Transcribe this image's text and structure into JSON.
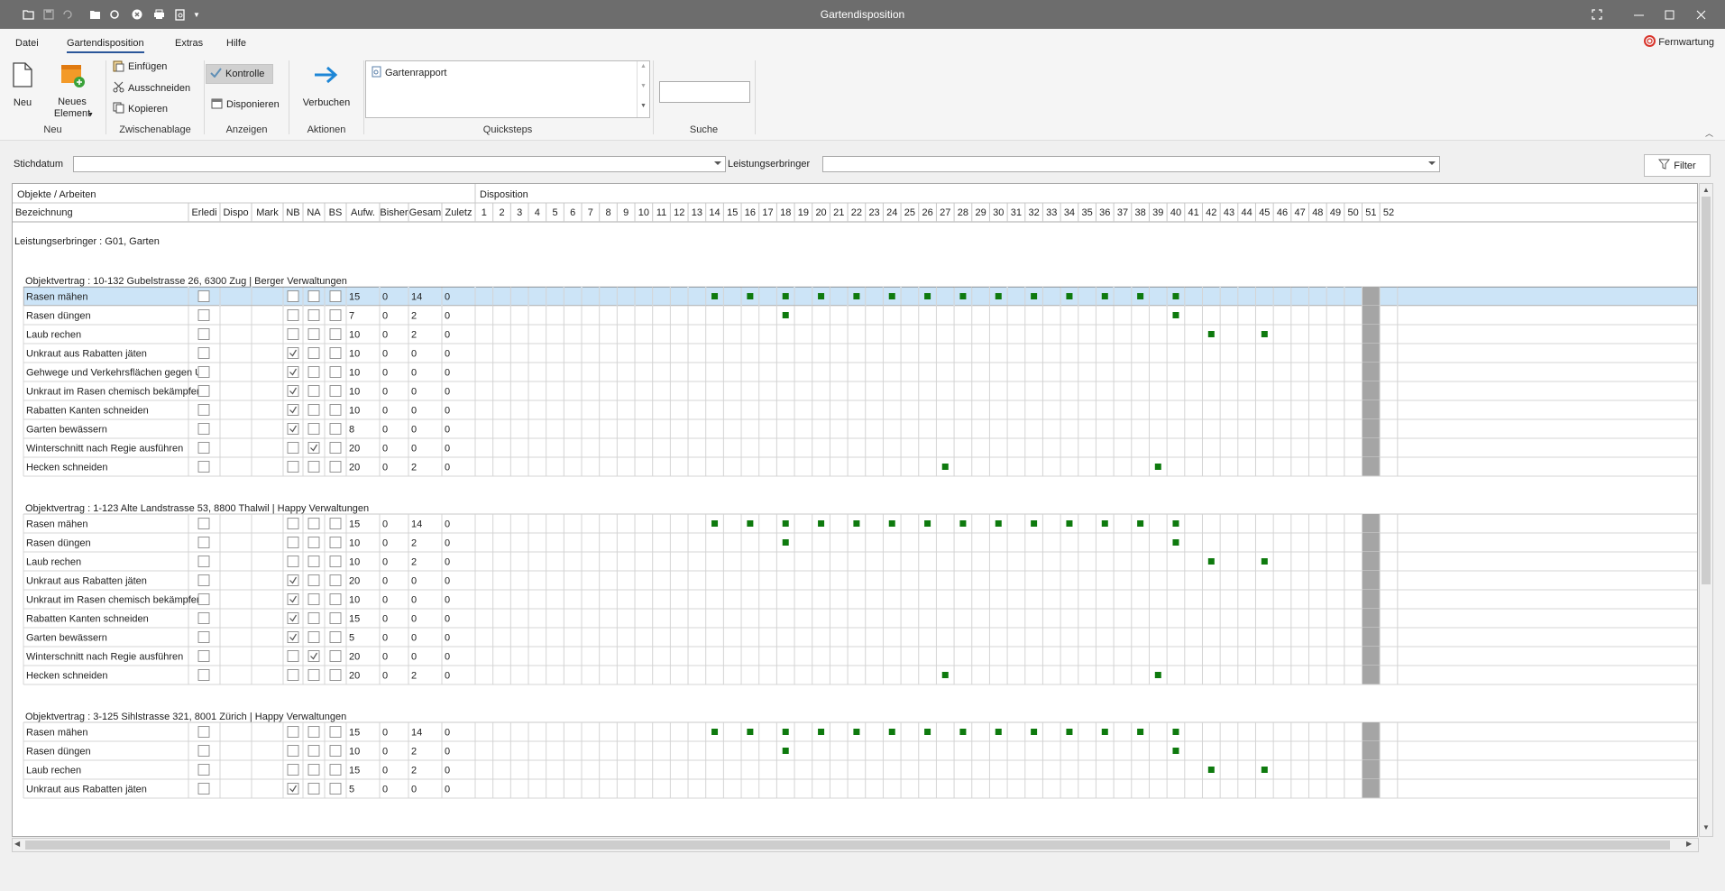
{
  "window": {
    "title": "Gartendisposition"
  },
  "menu": {
    "tabs": [
      "Datei",
      "Gartendisposition",
      "Extras",
      "Hilfe"
    ],
    "active": "Gartendisposition",
    "fernwartung": "Fernwartung"
  },
  "ribbon": {
    "neu": {
      "new_label": "Neu",
      "element_label_1": "Neues",
      "element_label_2": "Element",
      "group": "Neu"
    },
    "clipboard": {
      "paste": "Einfügen",
      "cut": "Ausschneiden",
      "copy": "Kopieren",
      "group": "Zwischenablage"
    },
    "view": {
      "check": "Kontrolle",
      "dispose": "Disponieren",
      "group": "Anzeigen"
    },
    "actions": {
      "book": "Verbuchen",
      "group": "Aktionen"
    },
    "quicksteps": {
      "items": [
        "Gartenrapport"
      ],
      "group": "Quicksteps"
    },
    "search": {
      "value": "",
      "group": "Suche"
    }
  },
  "filter": {
    "stichdatum_label": "Stichdatum",
    "stichdatum_value": "",
    "provider_label": "Leistungserbringer",
    "provider_value": "",
    "filter_button": "Filter"
  },
  "grid": {
    "band_left": "Objekte / Arbeiten",
    "band_right": "Disposition",
    "columns": [
      "Bezeichnung",
      "Erledi",
      "Dispo",
      "Mark",
      "NB",
      "NA",
      "BS",
      "Aufw.",
      "Bisher",
      "Gesam",
      "Zuletz"
    ],
    "weeks": [
      "1",
      "2",
      "3",
      "4",
      "5",
      "6",
      "7",
      "8",
      "9",
      "10",
      "11",
      "12",
      "13",
      "14",
      "15",
      "16",
      "17",
      "18",
      "19",
      "20",
      "21",
      "22",
      "23",
      "24",
      "25",
      "26",
      "27",
      "28",
      "29",
      "30",
      "31",
      "32",
      "33",
      "34",
      "35",
      "36",
      "37",
      "38",
      "39",
      "40",
      "41",
      "42",
      "43",
      "44",
      "45",
      "46",
      "47",
      "48",
      "49",
      "50",
      "51",
      "52"
    ],
    "highlight_week": "51",
    "group_label": "Leistungserbringer : G01, Garten",
    "contracts": [
      {
        "title": "Objektvertrag : 10-132 Gubelstrasse 26, 6300 Zug | Berger Verwaltungen",
        "rows": [
          {
            "name": "Rasen mähen",
            "nb": false,
            "na": false,
            "aufw": "15",
            "bisher": "0",
            "gesamt": "14",
            "zuletzt": "0",
            "weeks": [
              14,
              16,
              18,
              20,
              22,
              24,
              26,
              28,
              30,
              32,
              34,
              36,
              38,
              40
            ],
            "selected": true
          },
          {
            "name": "Rasen düngen",
            "nb": false,
            "na": false,
            "aufw": "7",
            "bisher": "0",
            "gesamt": "2",
            "zuletzt": "0",
            "weeks": [
              18,
              40
            ]
          },
          {
            "name": "Laub rechen",
            "nb": false,
            "na": false,
            "aufw": "10",
            "bisher": "0",
            "gesamt": "2",
            "zuletzt": "0",
            "weeks": [
              42,
              45
            ]
          },
          {
            "name": "Unkraut aus Rabatten jäten",
            "nb": true,
            "na": false,
            "aufw": "10",
            "bisher": "0",
            "gesamt": "0",
            "zuletzt": "0",
            "weeks": []
          },
          {
            "name": "Gehwege und Verkehrsflächen gegen U...",
            "nb": true,
            "na": false,
            "aufw": "10",
            "bisher": "0",
            "gesamt": "0",
            "zuletzt": "0",
            "weeks": []
          },
          {
            "name": "Unkraut im Rasen chemisch bekämpfen",
            "nb": true,
            "na": false,
            "aufw": "10",
            "bisher": "0",
            "gesamt": "0",
            "zuletzt": "0",
            "weeks": []
          },
          {
            "name": "Rabatten Kanten schneiden",
            "nb": true,
            "na": false,
            "aufw": "10",
            "bisher": "0",
            "gesamt": "0",
            "zuletzt": "0",
            "weeks": []
          },
          {
            "name": "Garten bewässern",
            "nb": true,
            "na": false,
            "aufw": "8",
            "bisher": "0",
            "gesamt": "0",
            "zuletzt": "0",
            "weeks": []
          },
          {
            "name": "Winterschnitt nach Regie ausführen",
            "nb": false,
            "na": true,
            "aufw": "20",
            "bisher": "0",
            "gesamt": "0",
            "zuletzt": "0",
            "weeks": []
          },
          {
            "name": "Hecken schneiden",
            "nb": false,
            "na": false,
            "aufw": "20",
            "bisher": "0",
            "gesamt": "2",
            "zuletzt": "0",
            "weeks": [
              27,
              39
            ]
          }
        ]
      },
      {
        "title": "Objektvertrag : 1-123 Alte Landstrasse 53, 8800 Thalwil | Happy Verwaltungen",
        "rows": [
          {
            "name": "Rasen mähen",
            "nb": false,
            "na": false,
            "aufw": "15",
            "bisher": "0",
            "gesamt": "14",
            "zuletzt": "0",
            "weeks": [
              14,
              16,
              18,
              20,
              22,
              24,
              26,
              28,
              30,
              32,
              34,
              36,
              38,
              40
            ]
          },
          {
            "name": "Rasen düngen",
            "nb": false,
            "na": false,
            "aufw": "10",
            "bisher": "0",
            "gesamt": "2",
            "zuletzt": "0",
            "weeks": [
              18,
              40
            ]
          },
          {
            "name": "Laub rechen",
            "nb": false,
            "na": false,
            "aufw": "10",
            "bisher": "0",
            "gesamt": "2",
            "zuletzt": "0",
            "weeks": [
              42,
              45
            ]
          },
          {
            "name": "Unkraut aus Rabatten jäten",
            "nb": true,
            "na": false,
            "aufw": "20",
            "bisher": "0",
            "gesamt": "0",
            "zuletzt": "0",
            "weeks": []
          },
          {
            "name": "Unkraut im Rasen chemisch bekämpfen",
            "nb": true,
            "na": false,
            "aufw": "10",
            "bisher": "0",
            "gesamt": "0",
            "zuletzt": "0",
            "weeks": []
          },
          {
            "name": "Rabatten Kanten schneiden",
            "nb": true,
            "na": false,
            "aufw": "15",
            "bisher": "0",
            "gesamt": "0",
            "zuletzt": "0",
            "weeks": []
          },
          {
            "name": "Garten bewässern",
            "nb": true,
            "na": false,
            "aufw": "5",
            "bisher": "0",
            "gesamt": "0",
            "zuletzt": "0",
            "weeks": []
          },
          {
            "name": "Winterschnitt nach Regie ausführen",
            "nb": false,
            "na": true,
            "aufw": "20",
            "bisher": "0",
            "gesamt": "0",
            "zuletzt": "0",
            "weeks": []
          },
          {
            "name": "Hecken schneiden",
            "nb": false,
            "na": false,
            "aufw": "20",
            "bisher": "0",
            "gesamt": "2",
            "zuletzt": "0",
            "weeks": [
              27,
              39
            ]
          }
        ]
      },
      {
        "title": "Objektvertrag : 3-125 Sihlstrasse 321, 8001 Zürich | Happy Verwaltungen",
        "rows": [
          {
            "name": "Rasen mähen",
            "nb": false,
            "na": false,
            "aufw": "15",
            "bisher": "0",
            "gesamt": "14",
            "zuletzt": "0",
            "weeks": [
              14,
              16,
              18,
              20,
              22,
              24,
              26,
              28,
              30,
              32,
              34,
              36,
              38,
              40
            ]
          },
          {
            "name": "Rasen düngen",
            "nb": false,
            "na": false,
            "aufw": "10",
            "bisher": "0",
            "gesamt": "2",
            "zuletzt": "0",
            "weeks": [
              18,
              40
            ]
          },
          {
            "name": "Laub rechen",
            "nb": false,
            "na": false,
            "aufw": "15",
            "bisher": "0",
            "gesamt": "2",
            "zuletzt": "0",
            "weeks": [
              42,
              45
            ]
          },
          {
            "name": "Unkraut aus Rabatten jäten",
            "nb": true,
            "na": false,
            "aufw": "5",
            "bisher": "0",
            "gesamt": "0",
            "zuletzt": "0",
            "weeks": []
          }
        ]
      }
    ]
  },
  "colors": {
    "marker": "#0e7a0e",
    "selection": "#cce4f7",
    "highlight_col": "#a5a5a5",
    "titlebar": "#6d6d6d",
    "accent": "#2b579a"
  }
}
